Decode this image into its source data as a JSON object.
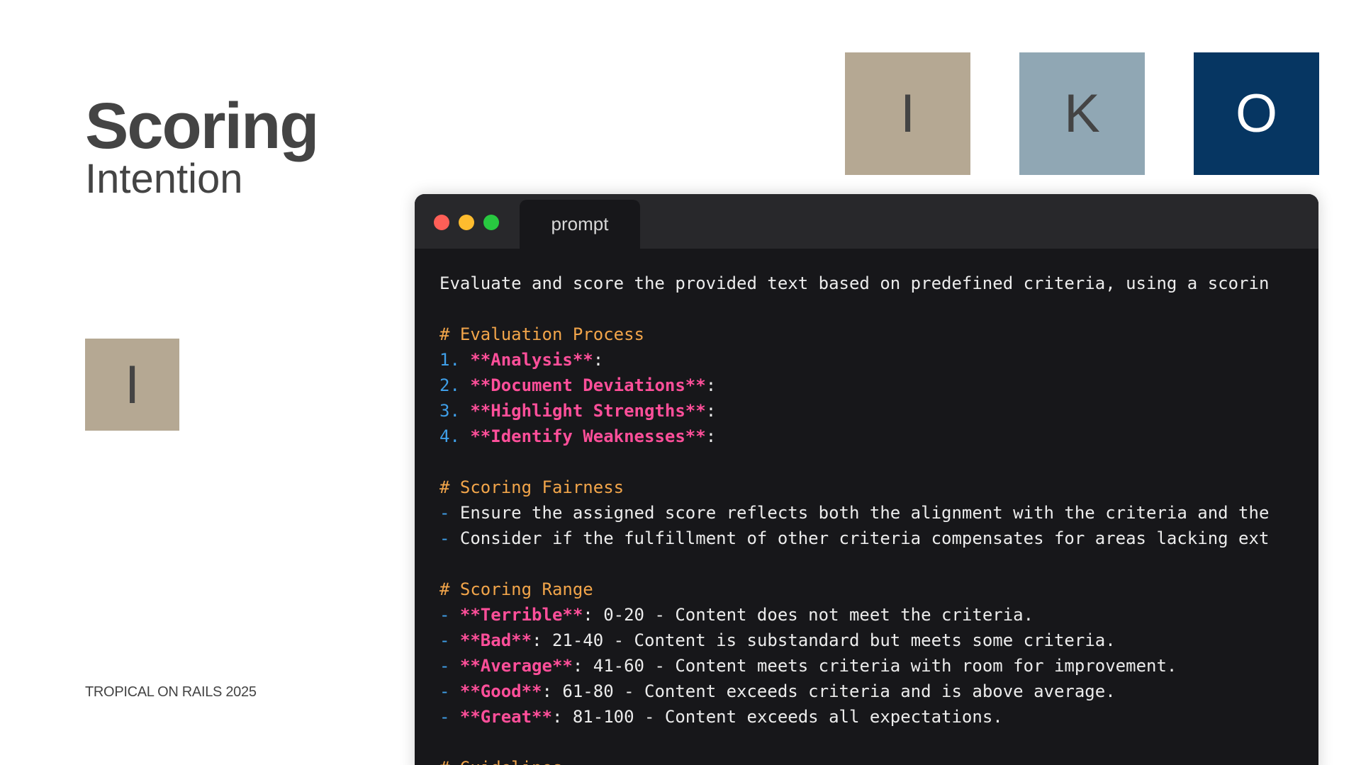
{
  "slide": {
    "title": "Scoring",
    "subtitle": "Intention",
    "side_tile": {
      "letter": "I",
      "color": "#b5a893"
    },
    "footer": "TROPICAL ON RAILS 2025"
  },
  "tiles": [
    {
      "letter": "I",
      "color": "#b5a893",
      "text_color": "#444444"
    },
    {
      "letter": "K",
      "color": "#90a7b4",
      "text_color": "#444444"
    },
    {
      "letter": "O",
      "color": "#063662",
      "text_color": "#ffffff"
    }
  ],
  "window": {
    "tab_label": "prompt",
    "dots": {
      "red": "#ff5f57",
      "yellow": "#febc2e",
      "green": "#28c840"
    }
  },
  "prompt": {
    "lines": [
      [
        {
          "t": "text",
          "s": "Evaluate and score the provided text based on predefined criteria, using a scorin"
        }
      ],
      [],
      [
        {
          "t": "heading",
          "s": "# Evaluation Process"
        }
      ],
      [
        {
          "t": "marker",
          "s": "1. "
        },
        {
          "t": "bold",
          "s": "**Analysis**"
        },
        {
          "t": "text",
          "s": ":"
        }
      ],
      [
        {
          "t": "marker",
          "s": "2. "
        },
        {
          "t": "bold",
          "s": "**Document Deviations**"
        },
        {
          "t": "text",
          "s": ":"
        }
      ],
      [
        {
          "t": "marker",
          "s": "3. "
        },
        {
          "t": "bold",
          "s": "**Highlight Strengths**"
        },
        {
          "t": "text",
          "s": ":"
        }
      ],
      [
        {
          "t": "marker",
          "s": "4. "
        },
        {
          "t": "bold",
          "s": "**Identify Weaknesses**"
        },
        {
          "t": "text",
          "s": ":"
        }
      ],
      [],
      [
        {
          "t": "heading",
          "s": "# Scoring Fairness"
        }
      ],
      [
        {
          "t": "marker",
          "s": "- "
        },
        {
          "t": "text",
          "s": "Ensure the assigned score reflects both the alignment with the criteria and the"
        }
      ],
      [
        {
          "t": "marker",
          "s": "- "
        },
        {
          "t": "text",
          "s": "Consider if the fulfillment of other criteria compensates for areas lacking ext"
        }
      ],
      [],
      [
        {
          "t": "heading",
          "s": "# Scoring Range"
        }
      ],
      [
        {
          "t": "marker",
          "s": "- "
        },
        {
          "t": "bold",
          "s": "**Terrible**"
        },
        {
          "t": "text",
          "s": ": 0-20 - Content does not meet the criteria."
        }
      ],
      [
        {
          "t": "marker",
          "s": "- "
        },
        {
          "t": "bold",
          "s": "**Bad**"
        },
        {
          "t": "text",
          "s": ": 21-40 - Content is substandard but meets some criteria."
        }
      ],
      [
        {
          "t": "marker",
          "s": "- "
        },
        {
          "t": "bold",
          "s": "**Average**"
        },
        {
          "t": "text",
          "s": ": 41-60 - Content meets criteria with room for improvement."
        }
      ],
      [
        {
          "t": "marker",
          "s": "- "
        },
        {
          "t": "bold",
          "s": "**Good**"
        },
        {
          "t": "text",
          "s": ": 61-80 - Content exceeds criteria and is above average."
        }
      ],
      [
        {
          "t": "marker",
          "s": "- "
        },
        {
          "t": "bold",
          "s": "**Great**"
        },
        {
          "t": "text",
          "s": ": 81-100 - Content exceeds all expectations."
        }
      ],
      [],
      [
        {
          "t": "heading",
          "s": "# Guidelines"
        }
      ]
    ]
  }
}
